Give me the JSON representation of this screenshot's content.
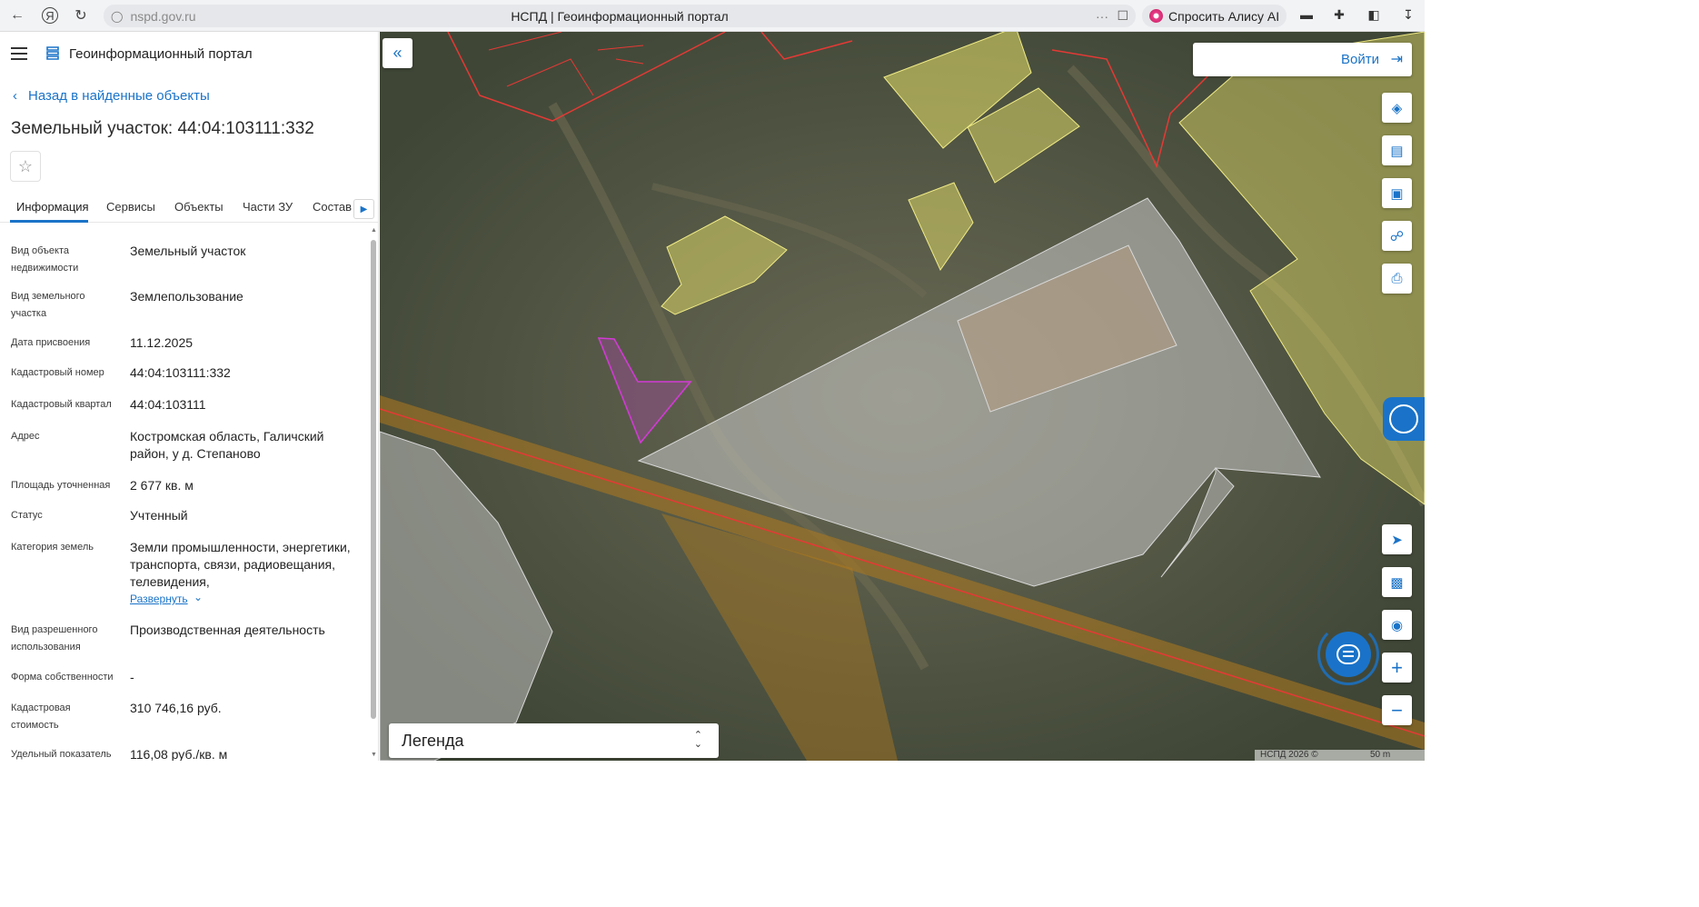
{
  "browser": {
    "url": "nspd.gov.ru",
    "tab_title": "НСПД | Геоинформационный портал",
    "alice_label": "Спросить Алису AI",
    "more_glyph": "···"
  },
  "header": {
    "portal_title": "Геоинформационный портал"
  },
  "panel": {
    "back_label": "Назад в найденные объекты",
    "object_title": "Земельный участок: 44:04:103111:332",
    "tabs": [
      "Информация",
      "Сервисы",
      "Объекты",
      "Части ЗУ",
      "Состав"
    ],
    "active_tab": "Информация",
    "expand_label": "Развернуть",
    "rows": [
      {
        "label": "Вид объекта недвижимости",
        "value": "Земельный участок"
      },
      {
        "label": "Вид земельного участка",
        "value": "Землепользование"
      },
      {
        "label": "Дата присвоения",
        "value": "11.12.2025"
      },
      {
        "label": "Кадастровый номер",
        "value": "44:04:103111:332"
      },
      {
        "label": "Кадастровый квартал",
        "value": "44:04:103111"
      },
      {
        "label": "Адрес",
        "value": "Костромская область, Галичский район, у д. Степаново"
      },
      {
        "label": "Площадь уточненная",
        "value": "2 677 кв. м"
      },
      {
        "label": "Статус",
        "value": "Учтенный"
      },
      {
        "label": "Категория земель",
        "value": "Земли промышленности, энергетики, транспорта, связи, радиовещания, телевидения,"
      },
      {
        "label": "Вид разрешенного использования",
        "value": "Производственная деятельность"
      },
      {
        "label": "Форма собственности",
        "value": "-"
      },
      {
        "label": "Кадастровая стоимость",
        "value": "310 746,16 руб."
      },
      {
        "label": "Удельный показатель",
        "value": "116,08 руб./кв. м"
      }
    ]
  },
  "map": {
    "login_label": "Войти",
    "legend_label": "Легенда",
    "copyright": "НСПД 2026 ©",
    "scale": "50 m",
    "tools": [
      "layers-icon",
      "ruler-icon",
      "area-select-icon",
      "share-icon",
      "print-icon",
      "navigate-icon",
      "picture-in-picture-icon",
      "location-search-icon",
      "zoom-in-icon",
      "zoom-out-icon"
    ],
    "colors": {
      "accent": "#1a73c8",
      "selected_parcel": "#d23ad6",
      "parcel_border": "#e53935",
      "building_fill": "#e8e26a",
      "zone_fill": "#c9c9c9",
      "corridor_fill": "#b07a1e"
    }
  }
}
